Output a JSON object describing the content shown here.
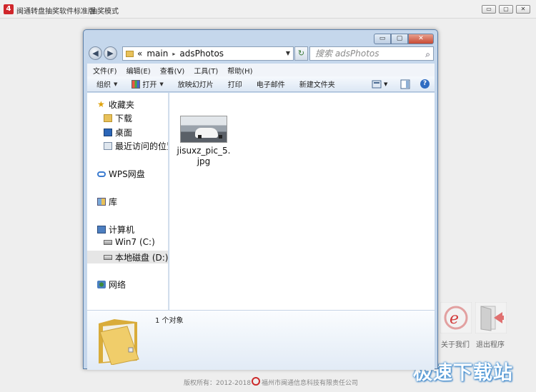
{
  "app": {
    "title": "闽通转盘抽奖软件标准版",
    "mode": "抽奖模式",
    "controls": [
      "▭",
      "▢",
      "✕"
    ],
    "copyright": "版权所有：2012-2018",
    "company": "福州市闽通信息科技有限责任公司",
    "side_buttons": [
      "关于我们",
      "退出程序"
    ],
    "watermark": "极速下载站"
  },
  "explorer": {
    "window_controls": [
      "▭",
      "▢",
      "✕"
    ],
    "nav": {
      "back": "◀",
      "forward": "▶",
      "refresh": "↻"
    },
    "address": {
      "chevron": "«",
      "segments": [
        "main",
        "adsPhotos"
      ],
      "separator": "▸",
      "dropdown": "▼"
    },
    "search": {
      "placeholder": "搜索 adsPhotos",
      "icon": "⌕"
    },
    "menu": [
      "文件(F)",
      "编辑(E)",
      "查看(V)",
      "工具(T)",
      "帮助(H)"
    ],
    "toolbar": {
      "organize": "组织",
      "open": "打开",
      "slideshow": "放映幻灯片",
      "print": "打印",
      "email": "电子邮件",
      "new_folder": "新建文件夹",
      "dropdown_arrow": "▼",
      "help": "?"
    },
    "sidebar": {
      "favorites": "收藏夹",
      "downloads": "下载",
      "desktop": "桌面",
      "recent": "最近访问的位置",
      "wps": "WPS网盘",
      "library": "库",
      "computer": "计算机",
      "drive_c": "Win7 (C:)",
      "drive_d": "本地磁盘 (D:)",
      "network": "网络"
    },
    "files": [
      {
        "name": "jisuxz_pic_5.jpg",
        "name_line1": "jisuxz_pic_5.",
        "name_line2": "jpg"
      }
    ],
    "status": {
      "count": "1 个对象"
    }
  },
  "colors": {
    "accent": "#d0262b",
    "selection": "#e6e6e6",
    "frame": "#c5d7ec"
  }
}
